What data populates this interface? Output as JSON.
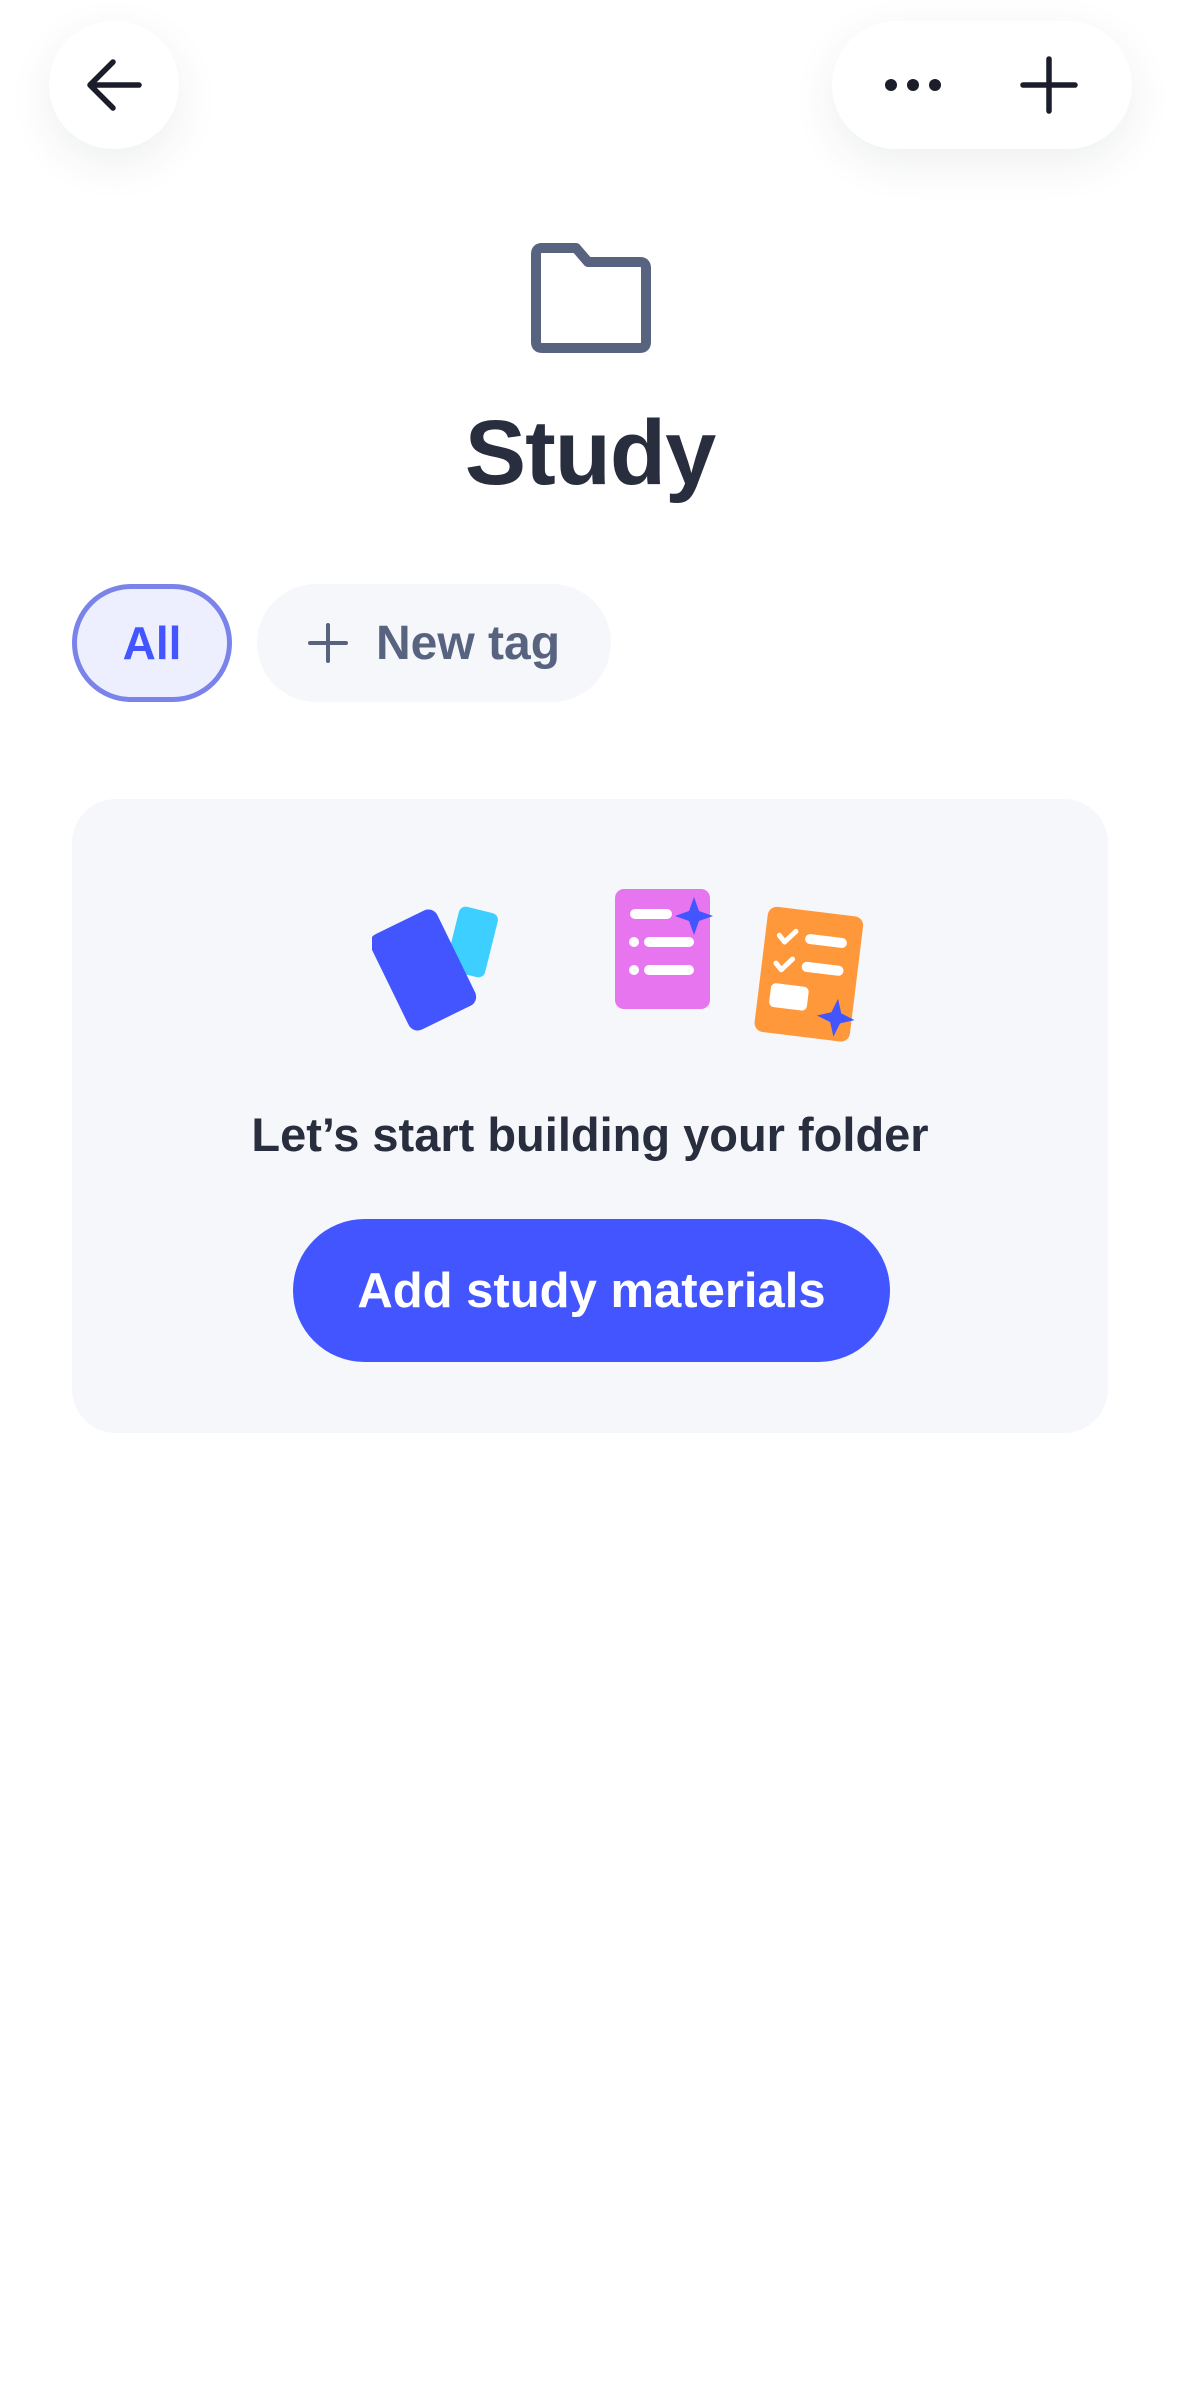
{
  "header": {
    "back_icon": "arrow-left-icon",
    "more_icon": "more-horizontal-icon",
    "add_icon": "plus-icon"
  },
  "folder": {
    "icon": "folder-icon",
    "title": "Study"
  },
  "tags": {
    "all_label": "All",
    "new_tag_label": "New tag",
    "selected": "All"
  },
  "empty_state": {
    "message": "Let’s start building your folder",
    "button_label": "Add study materials",
    "illustration_icons": [
      "flashcards-icon",
      "study-guide-icon",
      "practice-test-icon"
    ]
  },
  "colors": {
    "accent": "#4255ff",
    "title_text": "#282e3e",
    "secondary_text": "#586380",
    "card_background": "#f6f7fb",
    "tag_selected_bg": "#edefff",
    "tag_selected_border": "#7a83ea"
  }
}
